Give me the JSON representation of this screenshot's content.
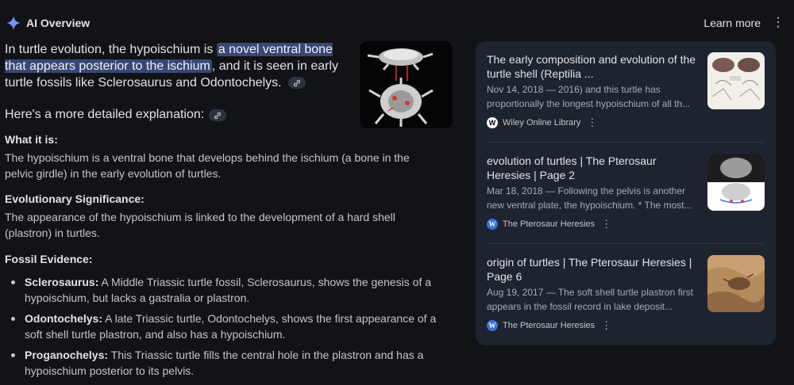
{
  "header": {
    "title": "AI Overview",
    "learn_more": "Learn more"
  },
  "intro": {
    "before": "In turtle evolution, the hypoischium is ",
    "highlight": "a novel ventral bone that appears posterior to the ischium",
    "after": ", and it is seen in early turtle fossils like Sclerosaurus and Odontochelys."
  },
  "detail_heading": "Here's a more detailed explanation:",
  "sections": [
    {
      "title": "What it is:",
      "text": "The hypoischium is a ventral bone that develops behind the ischium (a bone in the pelvic girdle) in the early evolution of turtles."
    },
    {
      "title": "Evolutionary Significance:",
      "text": "The appearance of the hypoischium is linked to the development of a hard shell (plastron) in turtles."
    },
    {
      "title": "Fossil Evidence:"
    }
  ],
  "fossils": [
    {
      "name": "Sclerosaurus:",
      "text": " A Middle Triassic turtle fossil, Sclerosaurus, shows the genesis of a hypoischium, but lacks a gastralia or plastron."
    },
    {
      "name": "Odontochelys:",
      "text": " A late Triassic turtle, Odontochelys, shows the first appearance of a soft shell turtle plastron, and also has a hypoischium."
    },
    {
      "name": "Proganochelys:",
      "text": " This Triassic turtle fills the central hole in the plastron and has a hypoischium posterior to its pelvis."
    }
  ],
  "sources": [
    {
      "title": "The early composition and evolution of the turtle shell (Reptilia ...",
      "snippet": "Nov 14, 2018 — 2016) and this turtle has proportionally the longest hypoischium of all th...",
      "site": "Wiley Online Library",
      "favicon": "W"
    },
    {
      "title": "evolution of turtles | The Pterosaur Heresies | Page 2",
      "snippet": "Mar 18, 2018 — Following the pelvis is another new ventral plate, the hypoischium. * The most...",
      "site": "The Pterosaur Heresies",
      "favicon": "W"
    },
    {
      "title": "origin of turtles | The Pterosaur Heresies | Page 6",
      "snippet": "Aug 19, 2017 — The soft shell turtle plastron first appears in the fossil record in lake deposit...",
      "site": "The Pterosaur Heresies",
      "favicon": "W"
    }
  ],
  "colors": {
    "background": "#121317",
    "panel": "#1e2330",
    "highlight": "#394775"
  }
}
